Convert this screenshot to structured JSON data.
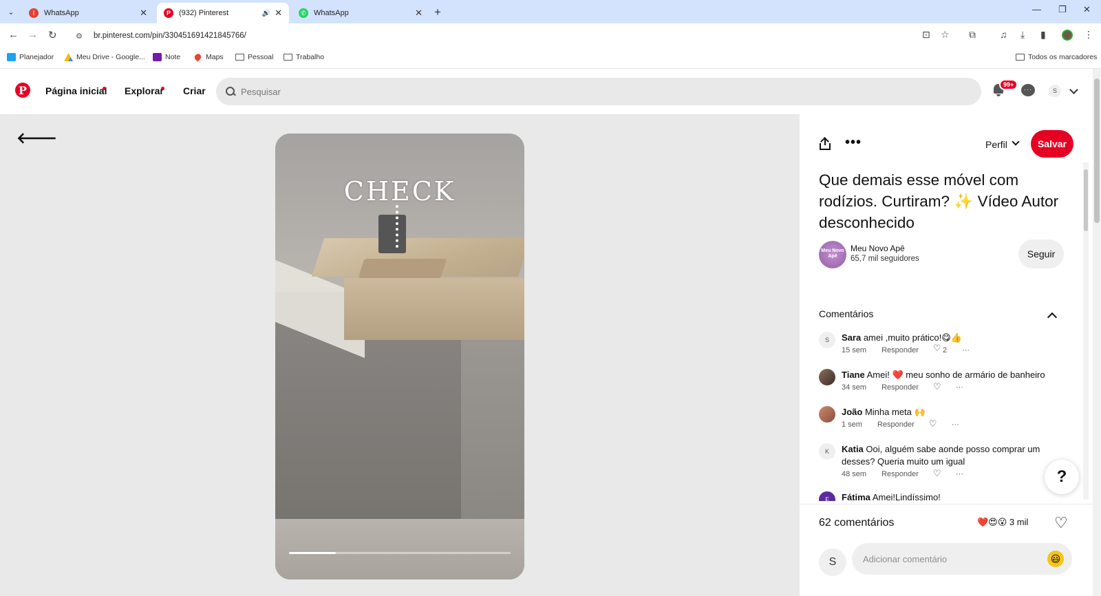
{
  "browser": {
    "tabs": [
      {
        "title": "WhatsApp",
        "favicon_color": "#e8402f",
        "active": false
      },
      {
        "title": "(932) Pinterest",
        "favicon_color": "#e60023",
        "active": true
      },
      {
        "title": "WhatsApp",
        "favicon_color": "#25d366",
        "active": false
      }
    ],
    "url": "br.pinterest.com/pin/330451691421845766/",
    "bookmarks": [
      {
        "label": "Planejador"
      },
      {
        "label": "Meu Drive - Google..."
      },
      {
        "label": "Note"
      },
      {
        "label": "Maps"
      },
      {
        "label": "Pessoal"
      },
      {
        "label": "Trabalho"
      }
    ],
    "all_bookmarks_label": "Todos os marcadores"
  },
  "header": {
    "logo": "P",
    "nav": {
      "home": "Página inicial",
      "explore": "Explorar",
      "create": "Criar"
    },
    "search_placeholder": "Pesquisar",
    "notifications_badge": "99+",
    "user_initial": "S",
    "brand_color": "#e60023"
  },
  "video": {
    "overlay_text": "CHECK",
    "progress": 0.21
  },
  "pin": {
    "perfil_label": "Perfil",
    "save_label": "Salvar",
    "title": "Que demais esse móvel com rodízios. Curtiram? ✨ Vídeo Autor desconhecido",
    "creator": {
      "name": "Meu Novo Apê",
      "followers": "65,7 mil seguidores",
      "avatar_text": "Meu Novo Apê"
    },
    "follow_label": "Seguir",
    "comments_heading": "Comentários",
    "comments": [
      {
        "initial": "S",
        "author": "Sara",
        "text": "amei ,muito prático!😋👍",
        "time": "15 sem",
        "reply": "Responder",
        "likes": "2"
      },
      {
        "initial": "",
        "author": "Tiane",
        "text": "Amei! ❤️ meu sonho de armário de banheiro",
        "time": "34 sem",
        "reply": "Responder",
        "likes": ""
      },
      {
        "initial": "",
        "author": "João",
        "text": "Minha meta 🙌",
        "time": "1 sem",
        "reply": "Responder",
        "likes": ""
      },
      {
        "initial": "K",
        "author": "Katia",
        "text": "Ooi, alguém sabe aonde posso comprar um desses? Queria muito um igual",
        "time": "48 sem",
        "reply": "Responder",
        "likes": ""
      },
      {
        "initial": "F",
        "author": "Fátima",
        "text": "Amei!Lindíssimo!",
        "time": "",
        "reply": "",
        "likes": ""
      }
    ],
    "comment_count": "62 comentários",
    "reactions_emoji": "❤️😍😮",
    "reactions_count": "3 mil",
    "my_initial": "S",
    "add_comment_placeholder": "Adicionar comentário",
    "emoji_button": "😃"
  },
  "help_label": "?"
}
